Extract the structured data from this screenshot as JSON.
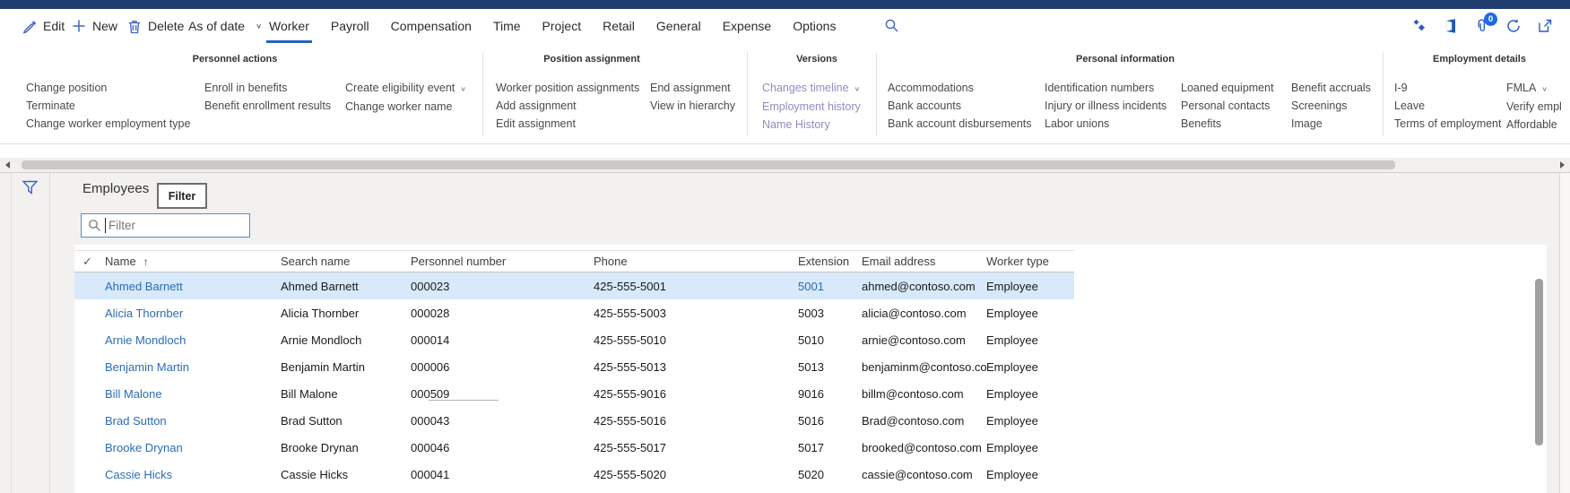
{
  "icons": {
    "chevron_down": "∨",
    "check": "✓",
    "sort_asc": "↑"
  },
  "toolbar": {
    "edit": "Edit",
    "new": "New",
    "delete": "Delete",
    "as_of_date": "As of date",
    "tabs": [
      {
        "label": "Worker",
        "selected": true
      },
      {
        "label": "Payroll"
      },
      {
        "label": "Compensation"
      },
      {
        "label": "Time"
      },
      {
        "label": "Project"
      },
      {
        "label": "Retail"
      },
      {
        "label": "General"
      },
      {
        "label": "Expense"
      },
      {
        "label": "Options"
      }
    ],
    "attachments_badge": "0"
  },
  "ribbon": {
    "groups": [
      {
        "title": "Personnel actions",
        "columns": [
          [
            "Change position",
            "Terminate",
            "Change worker employment type"
          ],
          [
            "Enroll in benefits",
            "Benefit enrollment results"
          ],
          [
            "Create eligibility event",
            "Change worker name"
          ]
        ]
      },
      {
        "title": "Position assignment",
        "columns": [
          [
            "Worker position assignments",
            "Add assignment",
            "Edit assignment"
          ],
          [
            "End assignment",
            "View in hierarchy"
          ]
        ]
      },
      {
        "title": "Versions",
        "columns": [
          [
            "Changes timeline",
            "Employment history",
            "Name History"
          ]
        ]
      },
      {
        "title": "Personal information",
        "columns": [
          [
            "Accommodations",
            "Bank accounts",
            "Bank account disbursements"
          ],
          [
            "Identification numbers",
            "Injury or illness incidents",
            "Labor unions"
          ],
          [
            "Loaned equipment",
            "Personal contacts",
            "Benefits"
          ],
          [
            "Benefit accruals",
            "Screenings",
            "Image"
          ]
        ]
      },
      {
        "title": "Employment details",
        "columns": [
          [
            "I-9",
            "Leave",
            "Terms of employment"
          ],
          [
            "FMLA",
            "Verify empl",
            "Affordable"
          ]
        ]
      }
    ]
  },
  "content": {
    "page_title": "Employees",
    "filter_tooltip": "Filter",
    "filter_placeholder": "Filter",
    "grid": {
      "columns": {
        "name": "Name",
        "search_name": "Search name",
        "personnel_number": "Personnel number",
        "phone": "Phone",
        "extension": "Extension",
        "email": "Email address",
        "worker_type": "Worker type"
      },
      "rows": [
        {
          "name": "Ahmed Barnett",
          "search_name": "Ahmed Barnett",
          "personnel_number": "000023",
          "phone": "425-555-5001",
          "extension": "5001",
          "email": "ahmed@contoso.com",
          "worker_type": "Employee",
          "selected": true
        },
        {
          "name": "Alicia Thornber",
          "search_name": "Alicia Thornber",
          "personnel_number": "000028",
          "phone": "425-555-5003",
          "extension": "5003",
          "email": "alicia@contoso.com",
          "worker_type": "Employee"
        },
        {
          "name": "Arnie Mondloch",
          "search_name": "Arnie Mondloch",
          "personnel_number": "000014",
          "phone": "425-555-5010",
          "extension": "5010",
          "email": "arnie@contoso.com",
          "worker_type": "Employee"
        },
        {
          "name": "Benjamin Martin",
          "search_name": "Benjamin Martin",
          "personnel_number": "000006",
          "phone": "425-555-5013",
          "extension": "5013",
          "email": "benjaminm@contoso.com",
          "worker_type": "Employee"
        },
        {
          "name": "Bill Malone",
          "search_name": "Bill Malone",
          "personnel_number": "000509",
          "phone": "425-555-9016",
          "extension": "9016",
          "email": "billm@contoso.com",
          "worker_type": "Employee"
        },
        {
          "name": "Brad Sutton",
          "search_name": "Brad Sutton",
          "personnel_number": "000043",
          "phone": "425-555-5016",
          "extension": "5016",
          "email": "Brad@contoso.com",
          "worker_type": "Employee"
        },
        {
          "name": "Brooke Drynan",
          "search_name": "Brooke Drynan",
          "personnel_number": "000046",
          "phone": "425-555-5017",
          "extension": "5017",
          "email": "brooked@contoso.com",
          "worker_type": "Employee"
        },
        {
          "name": "Cassie Hicks",
          "search_name": "Cassie Hicks",
          "personnel_number": "000041",
          "phone": "425-555-5020",
          "extension": "5020",
          "email": "cassie@contoso.com",
          "worker_type": "Employee"
        }
      ]
    }
  }
}
